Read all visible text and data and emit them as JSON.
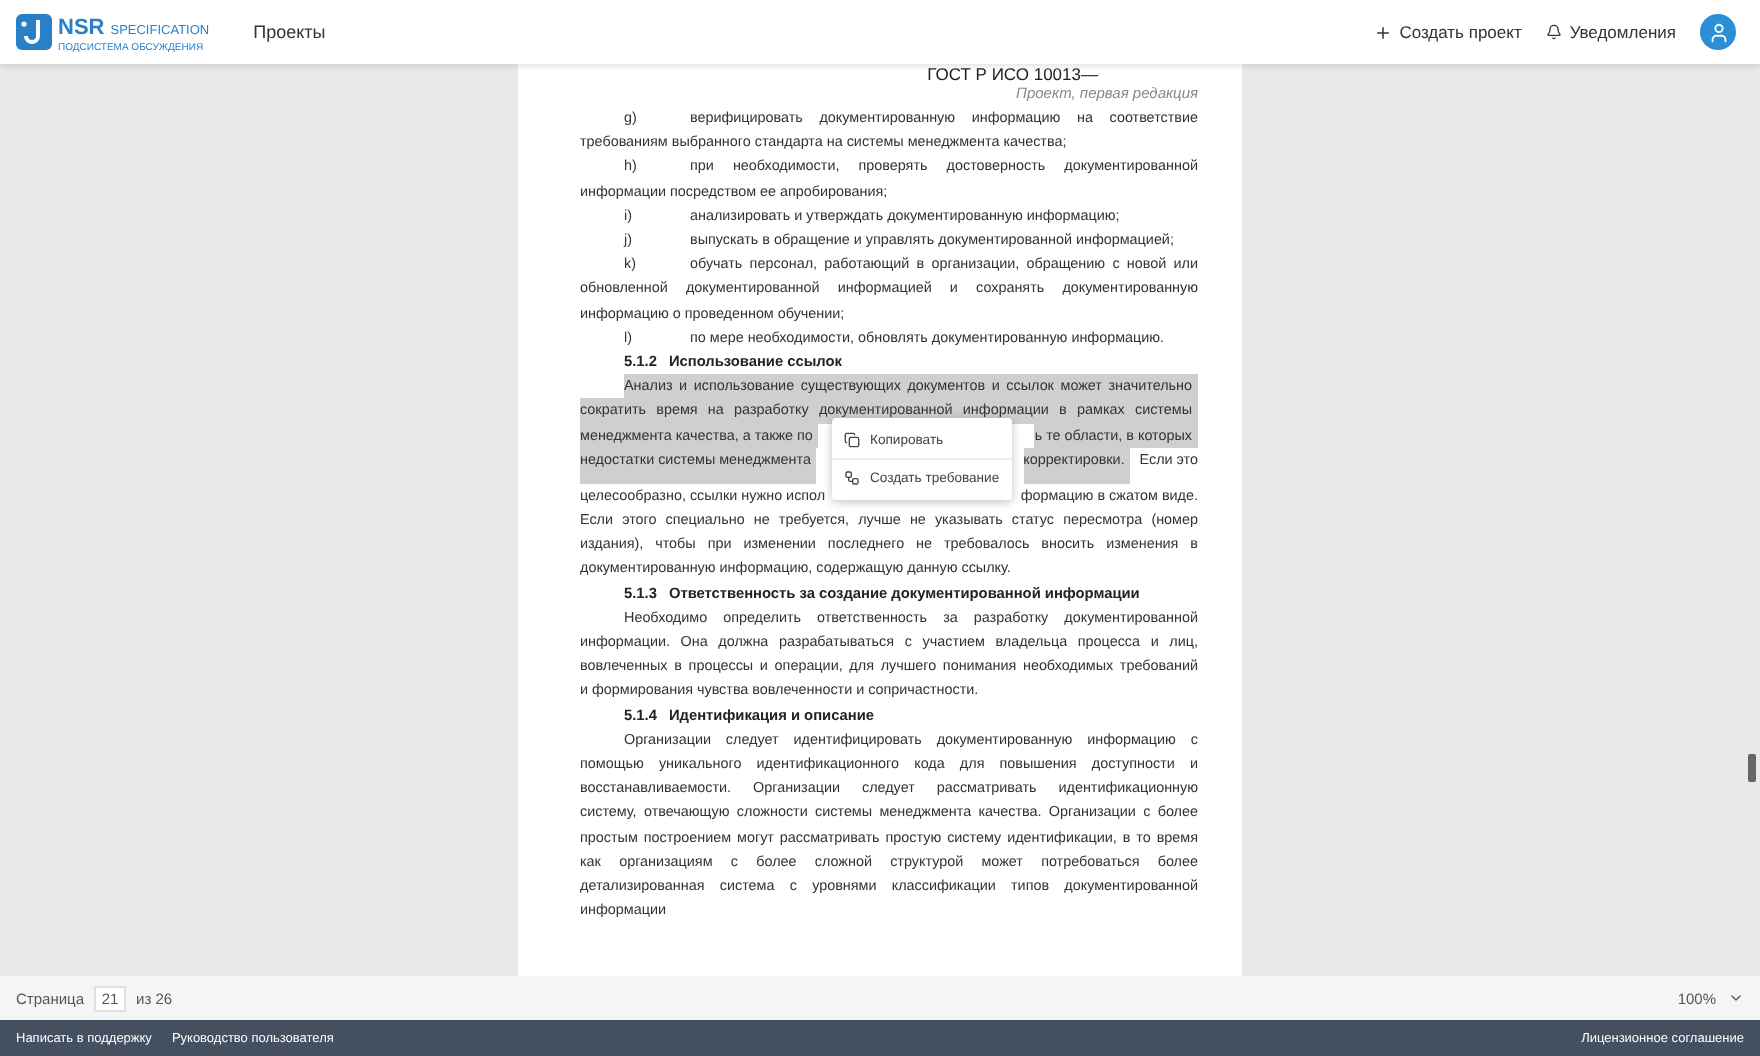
{
  "topbar": {
    "logo": {
      "brand": "NSR",
      "product": "SPECIFICATION",
      "subtitle": "ПОДСИСТЕМА ОБСУЖДЕНИЯ"
    },
    "nav": [
      "Проекты"
    ],
    "create_button": "Создать проект",
    "notifications": "Уведомления"
  },
  "document": {
    "header": {
      "code": "ГОСТ Р ИСО 10013—",
      "status": "Проект, первая редакция"
    },
    "blocks": [
      {
        "kind": "item",
        "marker": "g)",
        "lines": [
          "верифицировать документированную информацию на соответствие",
          "требованиям выбранного стандарта на системы менеджмента качества;"
        ]
      },
      {
        "kind": "item",
        "marker": "h)",
        "lines": [
          "при необходимости, проверять достоверность документированной",
          "информации посредством ее апробирования;"
        ]
      },
      {
        "kind": "item",
        "marker": "i)",
        "lines": [
          "анализировать и утверждать документированную информацию;"
        ]
      },
      {
        "kind": "item",
        "marker": "j)",
        "lines": [
          "выпускать в обращение и управлять документированной информацией;"
        ]
      },
      {
        "kind": "item",
        "marker": "k)",
        "lines": [
          "обучать персонал, работающий в организации, обращению с новой или",
          "обновленной документированной информацией и сохранять документированную",
          "информацию о проведенном обучении;"
        ]
      },
      {
        "kind": "item",
        "marker": "l)",
        "lines": [
          "по мере необходимости, обновлять документированную информацию."
        ]
      },
      {
        "kind": "heading",
        "number": "5.1.2",
        "title": "Использование ссылок"
      },
      {
        "kind": "selection_paragraph",
        "menu_here": true,
        "lines": [
          {
            "parts": [
              {
                "text": "Анализ и использование существующих документов и ссылок может значительно",
                "selected": true
              }
            ]
          },
          {
            "parts": [
              {
                "text": "сократить время на разработку документированной информации в рамках системы",
                "selected": true
              }
            ]
          },
          {
            "parts": [
              {
                "text": "менеджмента качества, а также по",
                "selected": true
              },
              {
                "text": "ь те области, в которых",
                "selected": true,
                "covered_before": true
              }
            ]
          },
          {
            "parts": [
              {
                "text": "недостатки системы менеджмента",
                "selected": true
              },
              {
                "text": "корректировки.",
                "selected": true,
                "covered_before": true
              },
              {
                "text": "Если это",
                "selected": false
              }
            ]
          },
          {
            "parts": [
              {
                "text": "целесообразно, ссылки нужно испол",
                "selected": false
              },
              {
                "text": "формацию в сжатом виде.",
                "selected": false,
                "covered_before": true
              }
            ]
          },
          {
            "parts": [
              {
                "text": "Если этого специально не требуется, лучше не указывать статус пересмотра (номер",
                "selected": false
              }
            ]
          },
          {
            "parts": [
              {
                "text": "издания), чтобы при изменении последнего не требовалось вносить изменения в",
                "selected": false
              }
            ]
          },
          {
            "parts": [
              {
                "text": "документированную информацию, содержащую данную ссылку.",
                "selected": false
              }
            ]
          }
        ]
      },
      {
        "kind": "heading",
        "number": "5.1.3",
        "title": "Ответственность за создание документированной информации"
      },
      {
        "kind": "paragraph",
        "lines": [
          "Необходимо определить ответственность за разработку документированной",
          "информации. Она должна разрабатываться с участием владельца процесса и лиц,",
          "вовлеченных в процессы и операции, для лучшего понимания необходимых требований",
          "и формирования чувства вовлеченности и сопричастности."
        ]
      },
      {
        "kind": "heading",
        "number": "5.1.4",
        "title": "Идентификация и описание"
      },
      {
        "kind": "paragraph",
        "lines": [
          "Организации следует идентифицировать документированную информацию с",
          "помощью уникального идентификационного кода для повышения доступности и",
          "восстанавливаемости. Организации следует рассматривать идентификационную",
          "систему, отвечающую сложности системы менеджмента качества. Организации с более",
          "простым построением могут рассматривать простую систему идентификации, в то время",
          "как организациям с более сложной структурой может потребоваться более",
          "детализированная система с уровнями классификации типов документированной",
          "информации"
        ]
      }
    ]
  },
  "context_menu": [
    {
      "kind": "copy",
      "label": "Копировать"
    },
    {
      "kind": "requirement",
      "label": "Создать требование"
    }
  ],
  "pager": {
    "label": "Страница",
    "page": "21",
    "of": "из 26",
    "zoom": "100%"
  },
  "footer": {
    "links": [
      "Написать в поддержку",
      "Руководство пользователя"
    ],
    "license": "Лицензионное соглашение"
  }
}
